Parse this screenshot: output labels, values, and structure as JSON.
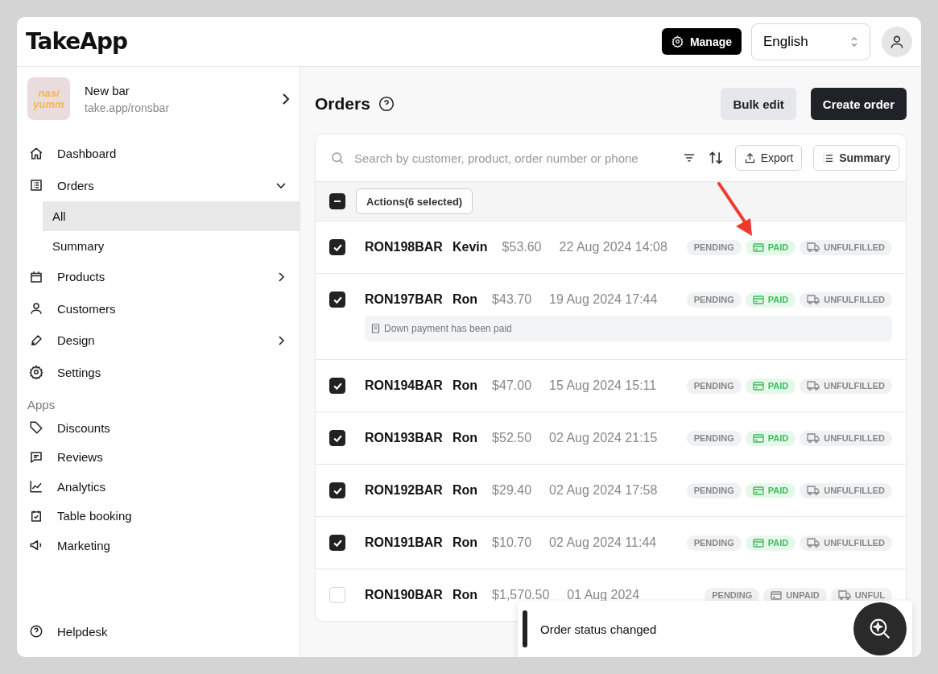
{
  "header": {
    "logo": "TakeApp",
    "manage_button": "Manage",
    "language": "English"
  },
  "store": {
    "name": "New bar",
    "url": "take.app/ronsbar",
    "logo_text": "nasi yumm"
  },
  "sidebar": {
    "items": [
      {
        "label": "Dashboard",
        "selected": false
      },
      {
        "label": "Orders",
        "selected": false,
        "expanded": true,
        "children": [
          {
            "label": "All",
            "selected": true
          },
          {
            "label": "Summary",
            "selected": false
          }
        ]
      },
      {
        "label": "Products",
        "selected": false,
        "expanded": false
      },
      {
        "label": "Customers",
        "selected": false
      },
      {
        "label": "Design",
        "selected": false,
        "expanded": false
      },
      {
        "label": "Settings",
        "selected": false
      }
    ],
    "apps_heading": "Apps",
    "apps": [
      {
        "label": "Discounts",
        "selected": false
      },
      {
        "label": "Reviews",
        "selected": false
      },
      {
        "label": "Analytics",
        "selected": false
      },
      {
        "label": "Table booking",
        "selected": false
      },
      {
        "label": "Marketing",
        "selected": false
      }
    ],
    "helpdesk": "Helpdesk"
  },
  "page": {
    "title": "Orders",
    "bulk_edit": "Bulk edit",
    "create_order": "Create order"
  },
  "toolbar": {
    "search_placeholder": "Search by customer, product, order number or phone",
    "export": "Export",
    "summary": "Summary"
  },
  "selection": {
    "mixed": true,
    "actions": "Actions(6 selected)"
  },
  "orders": [
    {
      "number": "RON198BAR",
      "customer": "Kevin",
      "total": "$53.60",
      "date": "22 Aug 2024 14:08",
      "checked": true,
      "status": "PENDING",
      "payment": {
        "label": "PAID",
        "kind": "paid"
      },
      "fulfillment": "UNFULFILLED"
    },
    {
      "number": "RON197BAR",
      "customer": "Ron",
      "total": "$43.70",
      "date": "19 Aug 2024 17:44",
      "checked": true,
      "status": "PENDING",
      "payment": {
        "label": "PAID",
        "kind": "paid"
      },
      "fulfillment": "UNFULFILLED",
      "note": "Down payment has been paid"
    },
    {
      "number": "RON194BAR",
      "customer": "Ron",
      "total": "$47.00",
      "date": "15 Aug 2024 15:11",
      "checked": true,
      "status": "PENDING",
      "payment": {
        "label": "PAID",
        "kind": "paid"
      },
      "fulfillment": "UNFULFILLED"
    },
    {
      "number": "RON193BAR",
      "customer": "Ron",
      "total": "$52.50",
      "date": "02 Aug 2024 21:15",
      "checked": true,
      "status": "PENDING",
      "payment": {
        "label": "PAID",
        "kind": "paid"
      },
      "fulfillment": "UNFULFILLED"
    },
    {
      "number": "RON192BAR",
      "customer": "Ron",
      "total": "$29.40",
      "date": "02 Aug 2024 17:58",
      "checked": true,
      "status": "PENDING",
      "payment": {
        "label": "PAID",
        "kind": "paid"
      },
      "fulfillment": "UNFULFILLED"
    },
    {
      "number": "RON191BAR",
      "customer": "Ron",
      "total": "$10.70",
      "date": "02 Aug 2024 11:44",
      "checked": true,
      "status": "PENDING",
      "payment": {
        "label": "PAID",
        "kind": "paid"
      },
      "fulfillment": "UNFULFILLED"
    },
    {
      "number": "RON190BAR",
      "customer": "Ron",
      "total": "$1,570.50",
      "date": "01 Aug 2024",
      "checked": false,
      "status": "PENDING",
      "payment": {
        "label": "UNPAID",
        "kind": "unpaid"
      },
      "fulfillment": "UNFUL"
    }
  ],
  "toast": {
    "message": "Order status changed"
  }
}
